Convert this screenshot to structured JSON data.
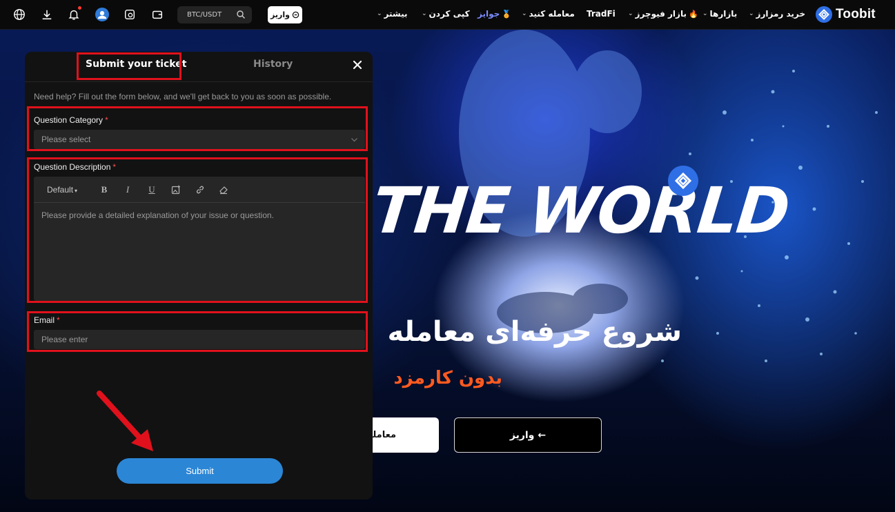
{
  "topbar": {
    "search_value": "BTC/USDT",
    "deposit_label": "واریز",
    "nav": {
      "buy_crypto": "خرید رمزارز",
      "markets": "بازارها",
      "futures": "بازار فیوچرز",
      "tradfi": "TradFi",
      "trade": "معامله کنید",
      "rewards": "جوایز",
      "copy_trade": "کپی کردن",
      "more": "بیشتر"
    },
    "logo_text": "Toobit",
    "icons": [
      "globe-icon",
      "download-icon",
      "bell-icon",
      "avatar-icon",
      "orders-icon",
      "wallet-icon"
    ]
  },
  "hero": {
    "world_text": "THE WORLD",
    "title": "شروع حرفه‌ای معامله",
    "subtitle": "بدون کارمزد",
    "btn_trade": "معامله",
    "btn_deposit": "واریز",
    "btn_deposit_arrow": "←"
  },
  "ticket": {
    "tab_submit": "Submit your ticket",
    "tab_history": "History",
    "help_text": "Need help? Fill out the form below, and we'll get back to you as soon as possible.",
    "category_label": "Question Category",
    "category_placeholder": "Please select",
    "description_label": "Question Description",
    "editor_default": "Default",
    "description_placeholder": "Please provide a detailed explanation of your issue or question.",
    "email_label": "Email",
    "email_placeholder": "Please enter",
    "required_mark": "*",
    "submit_label": "Submit"
  },
  "colors": {
    "highlight": "#e0111c",
    "submit": "#2b86d6",
    "accent_orange": "#ff5a1f",
    "brand_blue": "#2f6fe6"
  }
}
